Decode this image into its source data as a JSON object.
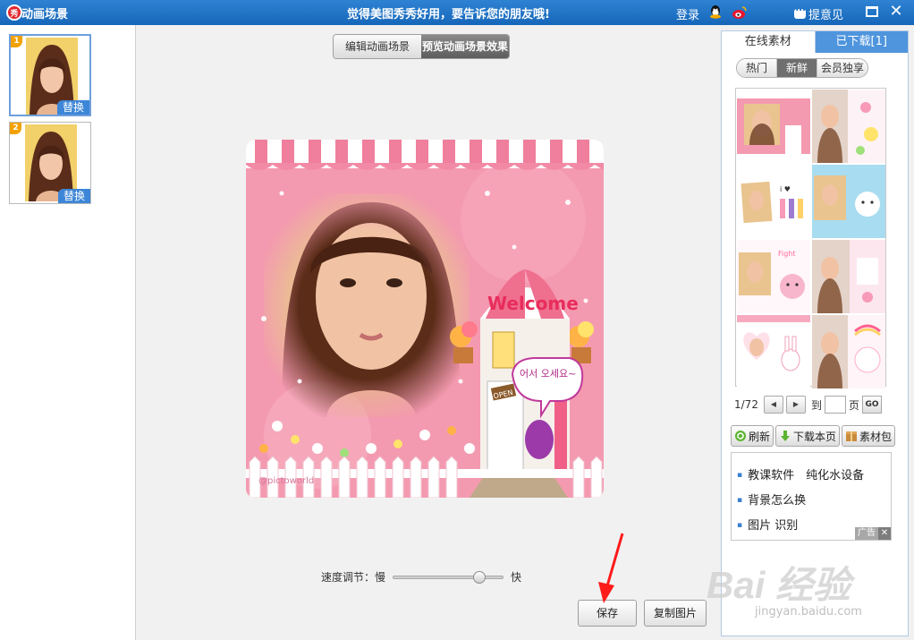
{
  "titlebar": {
    "logo_glyph": "秀",
    "title": "动画场景",
    "slogan": "觉得美图秀秀好用，要告诉您的朋友哦!",
    "login": "登录",
    "feedback": "提意见",
    "close_glyph": "✕"
  },
  "thumbnails": [
    {
      "number": "1",
      "replace_label": "替换",
      "selected": true
    },
    {
      "number": "2",
      "replace_label": "替换",
      "selected": false
    }
  ],
  "mode_tabs": [
    {
      "label": "编辑动画场景",
      "active": false
    },
    {
      "label": "预览动画场景效果",
      "active": true
    }
  ],
  "preview": {
    "welcome": "Welcome",
    "speech": "어서 오세요~",
    "credit": "@pictoworld",
    "open_sign": "OPEN"
  },
  "speed": {
    "label": "速度调节：",
    "slow": "慢",
    "fast": "快",
    "value": 0.82
  },
  "buttons": {
    "save": "保存",
    "copy": "复制图片"
  },
  "right_panel": {
    "tabs": [
      {
        "label": "在线素材",
        "active": true
      },
      {
        "label": "已下载[1]",
        "active": false
      }
    ],
    "sub_tabs": [
      {
        "label": "热门",
        "active": false
      },
      {
        "label": "新鲜",
        "active": true
      },
      {
        "label": "会员独享",
        "active": false
      }
    ],
    "tiles": [
      {
        "selected": true
      },
      {
        "selected": false
      },
      {
        "selected": false
      },
      {
        "selected": false
      },
      {
        "selected": false
      },
      {
        "selected": false
      },
      {
        "selected": false
      },
      {
        "selected": false
      }
    ],
    "pager": {
      "page_info": "1/72",
      "prev_glyph": "◀",
      "next_glyph": "▶",
      "to_label": "到",
      "page_value": "",
      "page_label": "页",
      "go": "GO"
    },
    "actions": {
      "refresh": "刷新",
      "download_page": "下载本页",
      "package": "素材包"
    },
    "ads": {
      "links": [
        "教课软件　纯化水设备",
        "背景怎么换",
        "图片 识别"
      ],
      "badge": "广告",
      "close_glyph": "✕"
    }
  },
  "watermark": {
    "logo_text": "Bai 经验",
    "url": "jingyan.baidu.com"
  },
  "colors": {
    "titlebar": "#1b6fc1",
    "accent_blue": "#3d86d7",
    "preview_pink": "#f49ab0"
  }
}
